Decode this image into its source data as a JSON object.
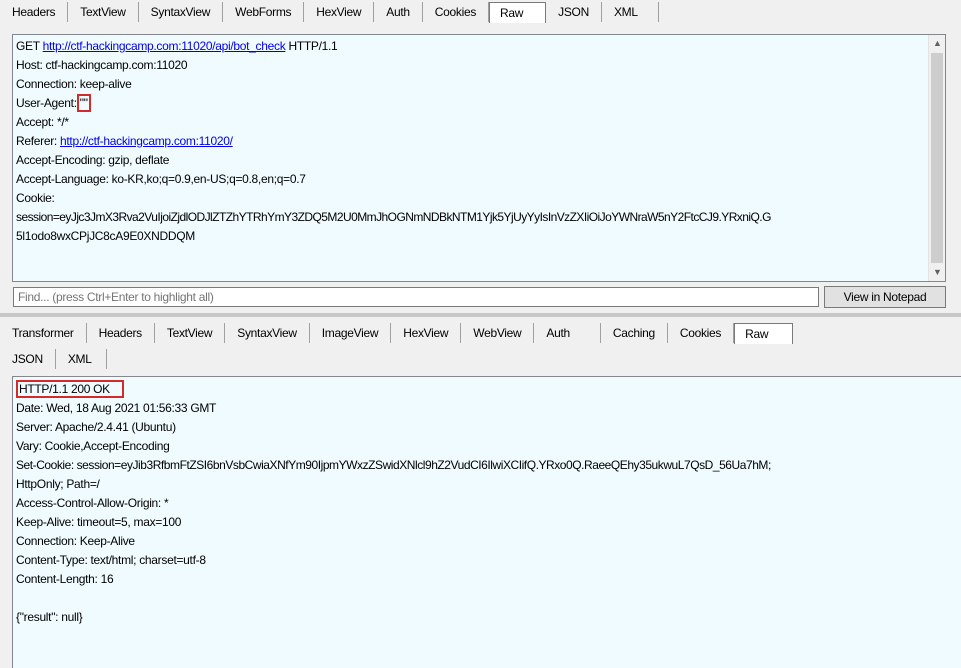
{
  "request": {
    "tabs": [
      "Headers",
      "TextView",
      "SyntaxView",
      "WebForms",
      "HexView",
      "Auth",
      "Cookies",
      "Raw",
      "JSON",
      "XML"
    ],
    "active_tab": "Raw",
    "method": "GET",
    "url": "http://ctf-hackingcamp.com:11020/api/bot_check",
    "protocol": "HTTP/1.1",
    "host": "Host: ctf-hackingcamp.com:11020",
    "connection": "Connection: keep-alive",
    "ua_key": "User-Agent:",
    "ua_value": "\"\"",
    "accept": "Accept: */*",
    "referer_key": "Referer:",
    "referer_url": "http://ctf-hackingcamp.com:11020/",
    "accept_encoding": "Accept-Encoding: gzip, deflate",
    "accept_language": "Accept-Language: ko-KR,ko;q=0.9,en-US;q=0.8,en;q=0.7",
    "cookie": "Cookie:",
    "session_line1": "session=eyJjc3JmX3Rva2VuIjoiZjdlODJlZTZhYTRhYmY3ZDQ5M2U0MmJhOGNmNDBkNTM1Yjk5YjUyYyIsInVzZXIiOiJoYWNraW5nY2FtcCJ9.YRxniQ.G",
    "session_line2": "5l1odo8wxCPjJC8cA9E0XNDDQM"
  },
  "find": {
    "placeholder": "Find... (press Ctrl+Enter to highlight all)",
    "notepad_label": "View in Notepad"
  },
  "response": {
    "tabs_row1": [
      "Transformer",
      "Headers",
      "TextView",
      "SyntaxView",
      "ImageView",
      "HexView",
      "WebView",
      "Auth",
      "Caching",
      "Cookies",
      "Raw"
    ],
    "tabs_row2": [
      "JSON",
      "XML"
    ],
    "active_tab": "Raw",
    "status": "HTTP/1.1 200 OK",
    "date": "Date: Wed, 18 Aug 2021 01:56:33 GMT",
    "server": "Server: Apache/2.4.41 (Ubuntu)",
    "vary": "Vary: Cookie,Accept-Encoding",
    "set_cookie": "Set-Cookie: session=eyJib3RfbmFtZSI6bnVsbCwiaXNfYm90IjpmYWxzZSwidXNlcl9hZ2VudCI6IlwiXCIifQ.YRxo0Q.RaeeQEhy35ukwuL7QsD_56Ua7hM;",
    "set_cookie_flags": "HttpOnly; Path=/",
    "acao": "Access-Control-Allow-Origin: *",
    "keep_alive": "Keep-Alive: timeout=5, max=100",
    "connection": "Connection: Keep-Alive",
    "content_type": "Content-Type: text/html; charset=utf-8",
    "content_length": "Content-Length: 16",
    "body": "{\"result\": null}"
  },
  "colors": {
    "pane_bg": "#f0fbff",
    "highlight_box": "#d42a2a",
    "link": "#0000ee"
  }
}
